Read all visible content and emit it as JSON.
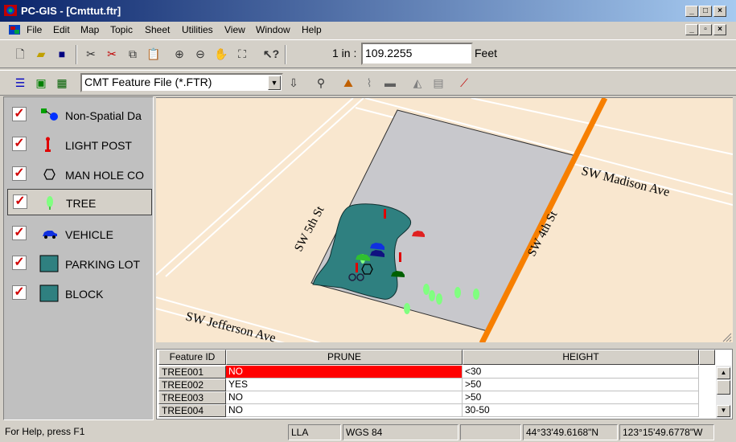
{
  "titlebar": {
    "title": "PC-GIS - [Cmttut.ftr]"
  },
  "menu": [
    "File",
    "Edit",
    "Map",
    "Topic",
    "Sheet",
    "Utilities",
    "View",
    "Window",
    "Help"
  ],
  "toolbar": {
    "scale_label": "1 in :",
    "scale_value": "109.2255",
    "scale_unit": "Feet"
  },
  "toolbar2": {
    "file_type": "CMT Feature File (*.FTR)"
  },
  "legend": [
    {
      "label": "Non-Spatial Da",
      "checked": true
    },
    {
      "label": "LIGHT POST",
      "checked": true
    },
    {
      "label": "MAN HOLE CO",
      "checked": true
    },
    {
      "label": "TREE",
      "checked": true
    },
    {
      "label": "VEHICLE",
      "checked": true
    },
    {
      "label": "PARKING LOT",
      "checked": true
    },
    {
      "label": "BLOCK",
      "checked": true
    }
  ],
  "map": {
    "streets": {
      "s5th": "SW 5th St",
      "s4th": "SW 4th St",
      "madison": "SW Madison Ave",
      "jefferson": "SW Jefferson Ave"
    },
    "colors": {
      "background": "#f9e7cf",
      "block": "#c8c8cc",
      "parking": "#2f8080",
      "highway": "#f77f00"
    }
  },
  "table": {
    "headers": [
      "Feature ID",
      "PRUNE",
      "HEIGHT"
    ],
    "rows": [
      {
        "id": "TREE001",
        "prune": "NO",
        "height": "<30"
      },
      {
        "id": "TREE002",
        "prune": "YES",
        "height": ">50"
      },
      {
        "id": "TREE003",
        "prune": "NO",
        "height": ">50"
      },
      {
        "id": "TREE004",
        "prune": "NO",
        "height": "30-50"
      }
    ],
    "selected_color": "#ff0000"
  },
  "status": {
    "help": "For Help, press F1",
    "proj": "LLA",
    "datum": "WGS 84",
    "lat": "44°33'49.6168\"N",
    "lon": "123°15'49.6778\"W"
  }
}
